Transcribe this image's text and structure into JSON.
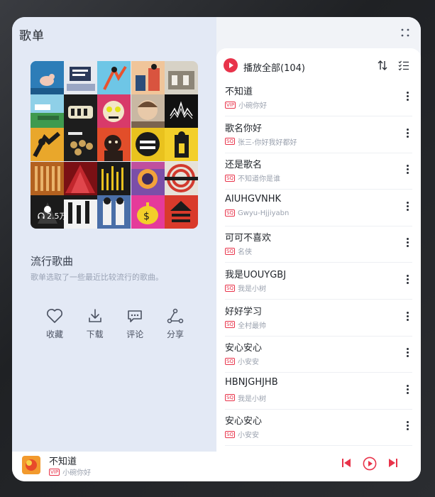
{
  "header": {
    "title": "歌单"
  },
  "playlist": {
    "play_count": "2.5万",
    "name": "流行歌曲",
    "description": "歌单选取了一些最近比较流行的歌曲。"
  },
  "actions": [
    {
      "label": "收藏",
      "icon": "heart-icon"
    },
    {
      "label": "下载",
      "icon": "download-icon"
    },
    {
      "label": "评论",
      "icon": "comment-icon"
    },
    {
      "label": "分享",
      "icon": "share-icon"
    }
  ],
  "list": {
    "play_all_label": "播放全部(104)",
    "songs": [
      {
        "title": "不知道",
        "badge": "VIP",
        "artist": "小碗你好"
      },
      {
        "title": "歌名你好",
        "badge": "SQ",
        "artist": "张三-你好我好都好"
      },
      {
        "title": "还是歌名",
        "badge": "SQ",
        "artist": "不知道你是谁"
      },
      {
        "title": "AIUHGVNHK",
        "badge": "SQ",
        "artist": "Gwyu-Hjjiyabn"
      },
      {
        "title": "可可不喜欢",
        "badge": "SQ",
        "artist": "名侠"
      },
      {
        "title": "我是UOUYGBJ",
        "badge": "SQ",
        "artist": "我是小树"
      },
      {
        "title": "好好学习",
        "badge": "SQ",
        "artist": "全村最帅"
      },
      {
        "title": "安心安心",
        "badge": "SQ",
        "artist": "小安安"
      },
      {
        "title": "HBNJGHJHB",
        "badge": "SQ",
        "artist": "我是小树"
      },
      {
        "title": "安心安心",
        "badge": "SQ",
        "artist": "小安安"
      }
    ]
  },
  "now_playing": {
    "title": "不知道",
    "badge": "VIP",
    "artist": "小碗你好"
  },
  "colors": {
    "accent": "#e8334a",
    "left_bg": "#e3e9f5",
    "text": "#1f2329",
    "subtext": "#9aa1ae"
  }
}
